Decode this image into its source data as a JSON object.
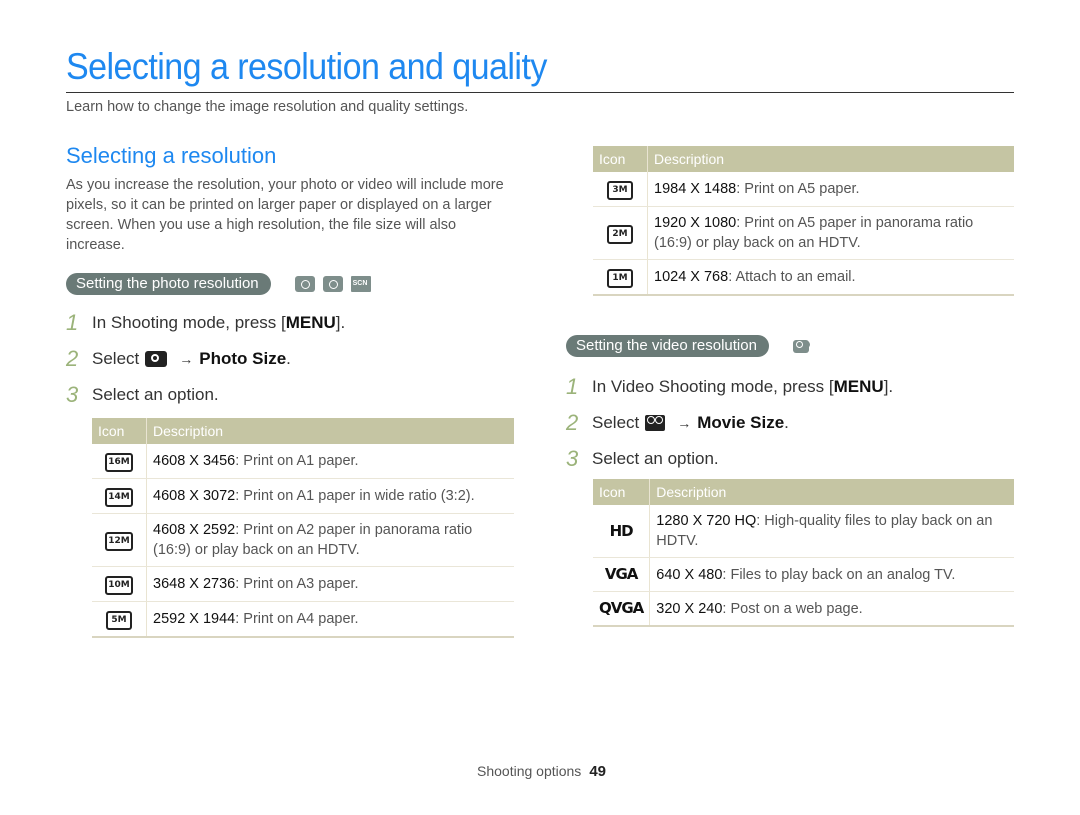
{
  "page": {
    "title": "Selecting a resolution and quality",
    "subtitle": "Learn how to change the image resolution and quality settings."
  },
  "resolution_section": {
    "title": "Selecting a resolution",
    "intro": "As you increase the resolution, your photo or video will include more pixels, so it can be printed on larger paper or displayed on a larger screen. When you use a high resolution, the file size will also increase."
  },
  "photo": {
    "pill": "Setting the photo resolution",
    "mode_icons": [
      "smart-mode-icon",
      "program-mode-icon",
      "scene-mode-icon"
    ],
    "steps": [
      {
        "num": "1",
        "pre": "In Shooting mode, press [",
        "key": "MENU",
        "post": "]."
      },
      {
        "num": "2",
        "pre": "Select",
        "icon": "camera-icon",
        "arrow": "→",
        "target": "Photo Size",
        "post": "."
      },
      {
        "num": "3",
        "pre": "Select an option."
      }
    ],
    "table": {
      "headers": [
        "Icon",
        "Description"
      ],
      "rows": [
        {
          "icon": "16M",
          "res": "4608 X 3456",
          "desc": ": Print on A1 paper."
        },
        {
          "icon": "14M",
          "res": "4608 X 3072",
          "desc": ": Print on A1 paper in wide ratio (3:2)."
        },
        {
          "icon": "12M",
          "res": "4608 X 2592",
          "desc": ": Print on A2 paper in panorama ratio (16:9) or play back on an HDTV."
        },
        {
          "icon": "10M",
          "res": "3648 X 2736",
          "desc": ": Print on A3 paper."
        },
        {
          "icon": "5M",
          "res": "2592 X 1944",
          "desc": ": Print on A4 paper."
        }
      ]
    },
    "table_cont": {
      "headers": [
        "Icon",
        "Description"
      ],
      "rows": [
        {
          "icon": "3M",
          "res": "1984 X 1488",
          "desc": ": Print on A5 paper."
        },
        {
          "icon": "2M",
          "res": "1920 X 1080",
          "desc": ": Print on A5 paper in panorama ratio (16:9) or play back on an HDTV."
        },
        {
          "icon": "1M",
          "res": "1024 X 768",
          "desc": ": Attach to an email."
        }
      ]
    }
  },
  "video": {
    "pill": "Setting the video resolution",
    "mode_icons": [
      "movie-mode-icon"
    ],
    "steps": [
      {
        "num": "1",
        "pre": "In Video Shooting mode, press [",
        "key": "MENU",
        "post": "]."
      },
      {
        "num": "2",
        "pre": "Select",
        "icon": "movie-icon",
        "arrow": "→",
        "target": "Movie Size",
        "post": "."
      },
      {
        "num": "3",
        "pre": "Select an option."
      }
    ],
    "table": {
      "headers": [
        "Icon",
        "Description"
      ],
      "rows": [
        {
          "icon": "HD",
          "res": "1280 X 720 HQ",
          "desc": ": High-quality files to play back on an HDTV."
        },
        {
          "icon": "VGA",
          "res": "640 X 480",
          "desc": ": Files to play back on an analog TV."
        },
        {
          "icon": "QVGA",
          "res": "320 X 240",
          "desc": ": Post on a web page."
        }
      ]
    }
  },
  "footer": {
    "section": "Shooting options",
    "page_number": "49"
  },
  "colors": {
    "accent": "#1e88f0",
    "pill": "#6a7a77",
    "table_header": "#c5c5a3",
    "step_number": "#9bb37a"
  }
}
